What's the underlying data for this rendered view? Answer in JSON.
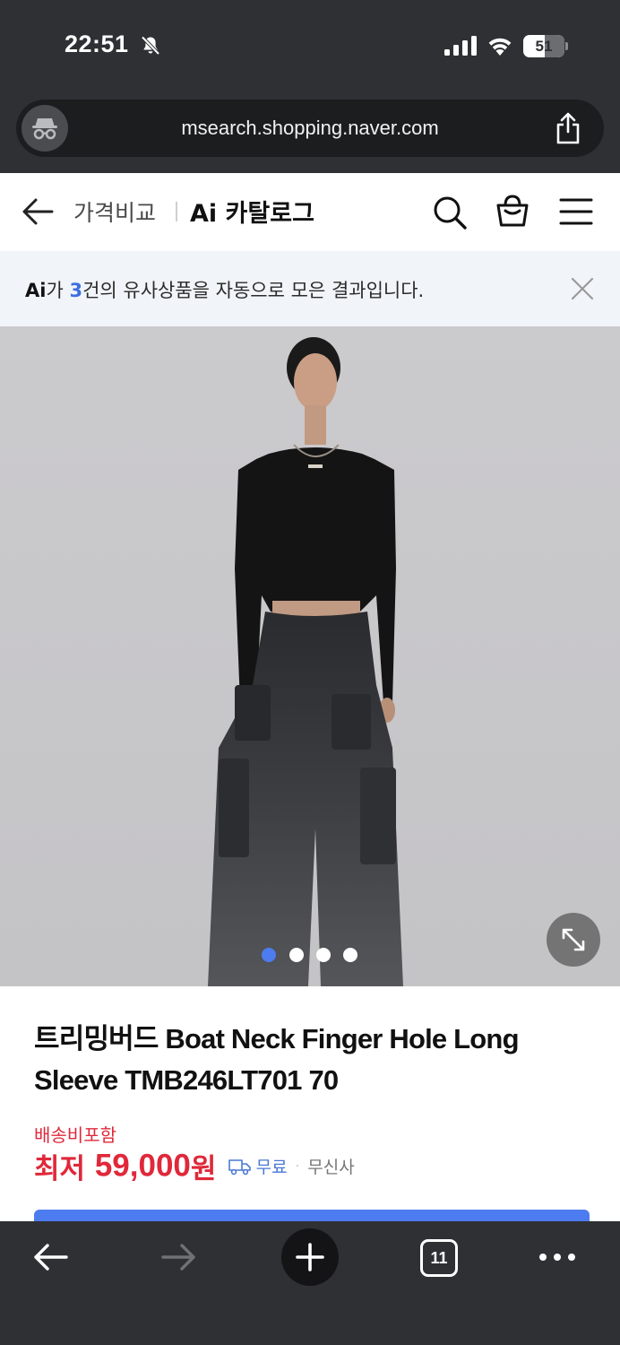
{
  "status_bar": {
    "time": "22:51",
    "battery": "51"
  },
  "browser": {
    "url": "msearch.shopping.naver.com",
    "tab_count": "11"
  },
  "nav": {
    "category": "가격비교",
    "brand": "Ai 카탈로그"
  },
  "banner": {
    "ai": "Ai",
    "pre": "가 ",
    "count": "3",
    "post": "건의 유사상품을 자동으로 모은 결과입니다."
  },
  "product": {
    "title": "트리밍버드 Boat Neck Finger Hole Long Sleeve TMB246LT701 70",
    "shipping_note": "배송비포함",
    "price_label": "최저 ",
    "price": "59,000",
    "price_unit": "원",
    "delivery": "무료",
    "seller": "무신사"
  },
  "carousel": {
    "total": 4,
    "active": 1
  },
  "colors": {
    "accent": "#3d6fe0",
    "price_red": "#e0283a",
    "chrome_dark": "#2e3033",
    "dot_active": "#4d7cf0"
  },
  "icons": [
    "bell-off-icon",
    "signal-icon",
    "wifi-icon",
    "battery-icon",
    "incognito-icon",
    "share-icon",
    "back-arrow-icon",
    "search-icon",
    "shopping-bag-icon",
    "menu-icon",
    "close-icon",
    "expand-icon",
    "truck-icon",
    "plus-icon",
    "more-icon"
  ]
}
